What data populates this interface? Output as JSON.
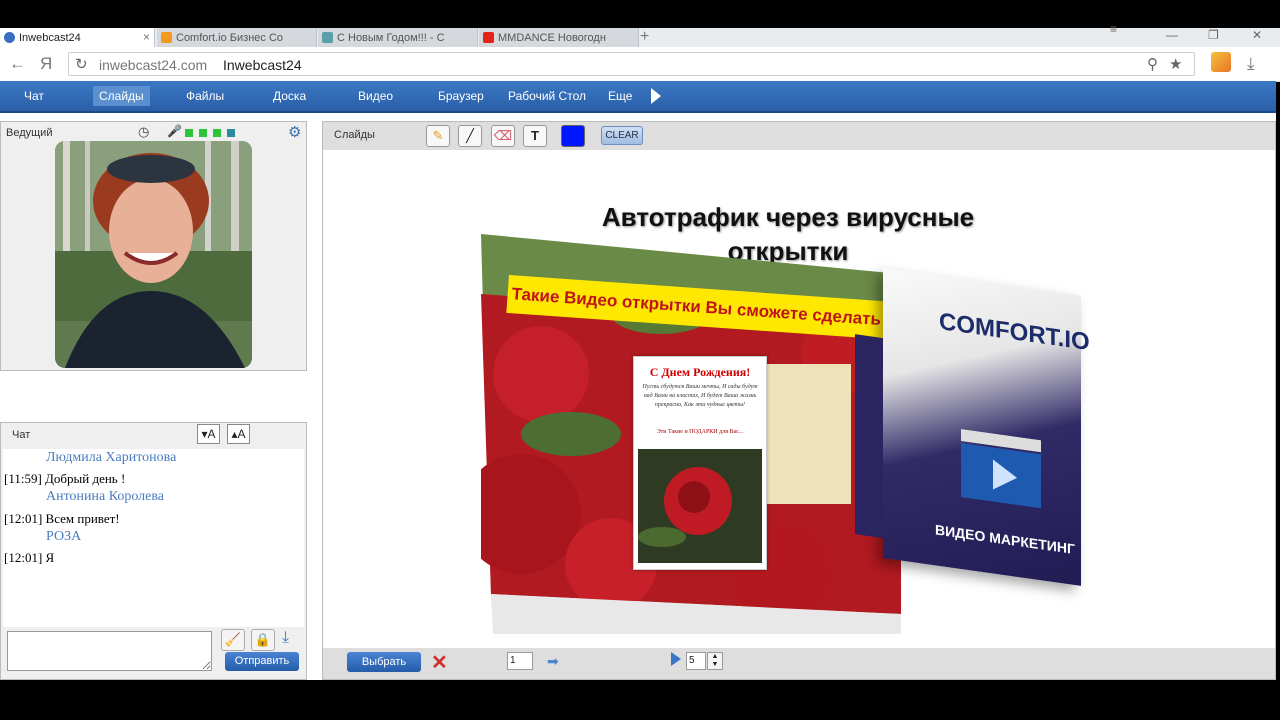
{
  "browser": {
    "tabs": [
      {
        "label": "Inwebcast24",
        "active": true
      },
      {
        "label": "Comfort.io Бизнес Со",
        "active": false
      },
      {
        "label": "С Новым Годом!!! - С",
        "active": false
      },
      {
        "label": "MMDANCE Новогодн",
        "active": false
      }
    ],
    "new_tab": "+",
    "back": "←",
    "yandex": "Я",
    "reload": "↻",
    "url_host": "inwebcast24.com",
    "page_title": "Inwebcast24"
  },
  "app_nav": {
    "items": [
      {
        "label": "Чат"
      },
      {
        "label": "Слайды",
        "selected": true
      },
      {
        "label": "Файлы"
      },
      {
        "label": "Доска"
      },
      {
        "label": "Видео"
      },
      {
        "label": "Браузер"
      },
      {
        "label": "Рабочий Стол"
      },
      {
        "label": "Еще"
      }
    ]
  },
  "host_panel": {
    "label": "Ведущий",
    "status_colors": [
      "#2ec43a",
      "#2ec43a",
      "#2ec43a",
      "#2a8aa0"
    ]
  },
  "chat": {
    "label": "Чат",
    "font_decrease": "▾A",
    "font_increase": "▴A",
    "messages": [
      {
        "author": "Людмила Харитонова",
        "time": "[11:59]",
        "text": "Добрый день !"
      },
      {
        "author": "Антонина Королева",
        "time": "[12:01]",
        "text": "Всем привет!"
      },
      {
        "author": "РОЗА",
        "time": "[12:01]",
        "text": "Я"
      }
    ],
    "input_value": "",
    "send_label": "Отправить"
  },
  "slides": {
    "label": "Слайды",
    "clear_label": "CLEAR",
    "color_swatch": "#0018ff",
    "slide_title_line1": "Автотрафик через вирусные",
    "slide_title_line2": "открытки",
    "banner_text": "Такие Видео открытки Вы сможете сделать за н",
    "card_title": "С Днем Рождения!",
    "card_poem": "Пусть сбудутся Ваши мечты, И сады будут над Вами на кластах, И будет Ваша жизнь прекрасна, Как эти чудные цветы!",
    "card_footer": "Эти Такие и ПОДАРКИ для Вас...",
    "product_logo": "COMFORT.IO",
    "product_title": "ВИДЕО МАРКЕТИНГ",
    "product_side": "ВИДЕО МАРКЕТИНГ",
    "select_label": "Выбрать",
    "page_value": "1",
    "count_value": "5"
  }
}
